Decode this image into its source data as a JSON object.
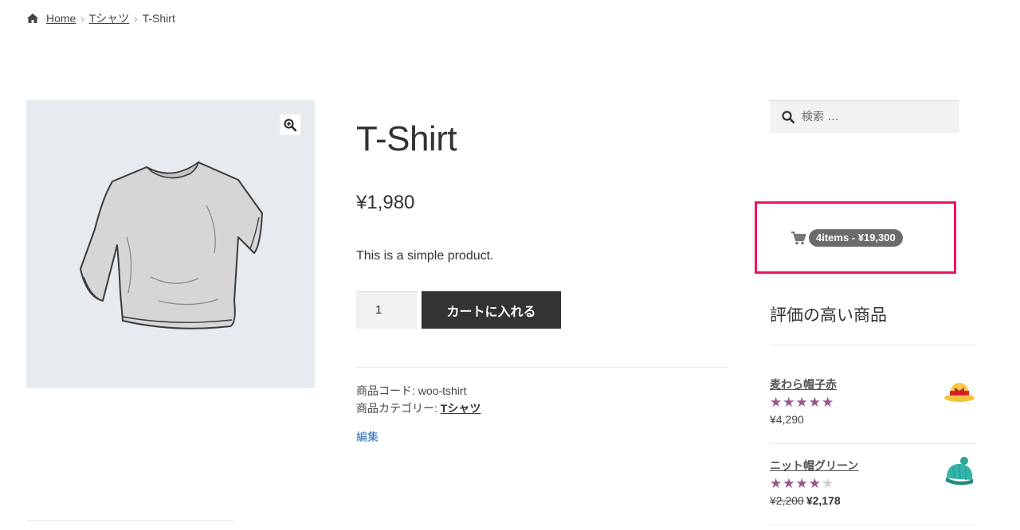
{
  "breadcrumb": {
    "home": "Home",
    "category": "Tシャツ",
    "current": "T-Shirt",
    "separator": "›"
  },
  "product": {
    "title": "T-Shirt",
    "price": "¥1,980",
    "description": "This is a simple product.",
    "quantity": "1",
    "add_to_cart": "カートに入れる",
    "sku_label": "商品コード:",
    "sku_value": "woo-tshirt",
    "category_label": "商品カテゴリー:",
    "category_value": "Tシャツ",
    "edit_link": "編集"
  },
  "sidebar": {
    "search_placeholder": "検索 …",
    "cart_summary": "4items - ¥19,300",
    "top_rated_title": "評価の高い商品",
    "products": [
      {
        "name": "麦わら帽子赤",
        "rating": 5,
        "price": "¥4,290",
        "icon": "straw-hat-icon"
      },
      {
        "name": "ニット帽グリーン",
        "rating": 4,
        "regular_price": "¥2,200",
        "sale_price": "¥2,178",
        "icon": "knit-hat-icon"
      }
    ]
  },
  "colors": {
    "button_bg": "#333333",
    "highlight_border": "#f0145a",
    "star": "#96588a",
    "link_blue": "#2c6db6"
  }
}
